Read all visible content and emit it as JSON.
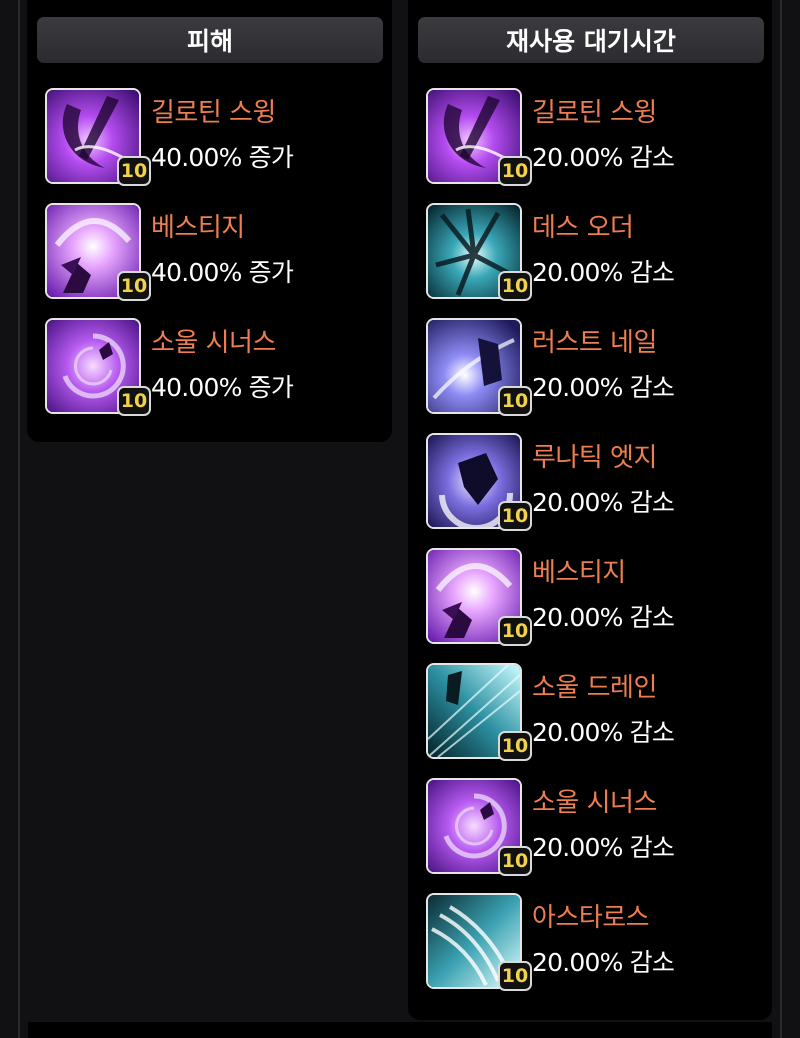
{
  "damage_panel": {
    "title": "피해",
    "skills": [
      {
        "name": "길로틴 스윙",
        "effect": "40.00% 증가",
        "level": "10",
        "icon": "guillotine-swing-icon"
      },
      {
        "name": "베스티지",
        "effect": "40.00% 증가",
        "level": "10",
        "icon": "vestige-icon"
      },
      {
        "name": "소울 시너스",
        "effect": "40.00% 증가",
        "level": "10",
        "icon": "soul-sinus-icon"
      }
    ]
  },
  "cooldown_panel": {
    "title": "재사용 대기시간",
    "skills": [
      {
        "name": "길로틴 스윙",
        "effect": "20.00% 감소",
        "level": "10",
        "icon": "guillotine-swing-icon"
      },
      {
        "name": "데스 오더",
        "effect": "20.00% 감소",
        "level": "10",
        "icon": "death-order-icon"
      },
      {
        "name": "러스트 네일",
        "effect": "20.00% 감소",
        "level": "10",
        "icon": "rust-nail-icon"
      },
      {
        "name": "루나틱 엣지",
        "effect": "20.00% 감소",
        "level": "10",
        "icon": "lunatic-edge-icon"
      },
      {
        "name": "베스티지",
        "effect": "20.00% 감소",
        "level": "10",
        "icon": "vestige-icon"
      },
      {
        "name": "소울 드레인",
        "effect": "20.00% 감소",
        "level": "10",
        "icon": "soul-drain-icon"
      },
      {
        "name": "소울 시너스",
        "effect": "20.00% 감소",
        "level": "10",
        "icon": "soul-sinus-icon"
      },
      {
        "name": "아스타로스",
        "effect": "20.00% 감소",
        "level": "10",
        "icon": "astaroth-icon"
      }
    ]
  },
  "colors": {
    "skill_name": "#ee7d50",
    "effect_text": "#ffffff",
    "level_text": "#f2d24a",
    "panel_bg": "#000000",
    "header_bg": "#333337"
  }
}
